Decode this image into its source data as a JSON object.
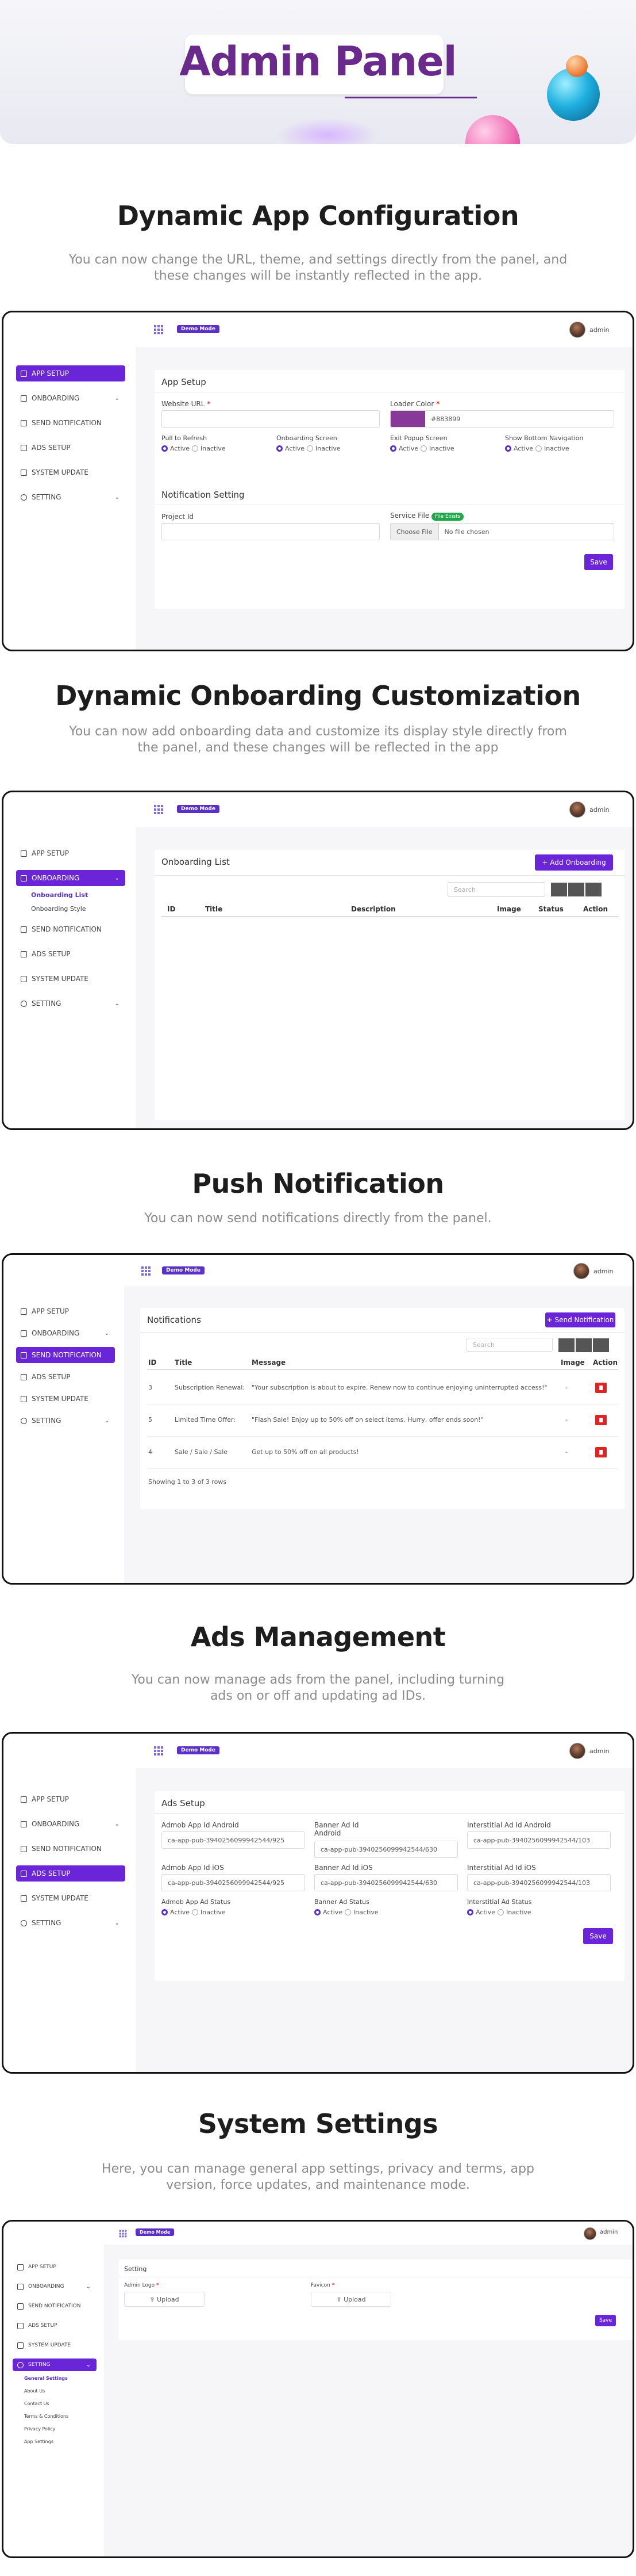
{
  "hero": {
    "title": "Admin Panel"
  },
  "sections": [
    {
      "title": "Dynamic App Configuration",
      "desc": "You can now change the URL, theme, and settings directly from the panel, and these changes will be instantly reflected in the app."
    },
    {
      "title": "Dynamic Onboarding Customization",
      "desc": "You can now add onboarding data and customize its display style directly from the panel, and these changes will be reflected in the app"
    },
    {
      "title": "Push Notification",
      "desc": "You can now send notifications directly from the panel."
    },
    {
      "title": "Ads Management",
      "desc": "You can now manage ads from the panel, including turning ads on or off and updating ad IDs."
    },
    {
      "title": "System Settings",
      "desc": "Here, you can manage general app settings, privacy and terms, app version, force updates, and maintenance mode."
    }
  ],
  "topbar": {
    "mode": "Demo Mode",
    "user": "admin"
  },
  "sidebar": {
    "items": [
      "APP SETUP",
      "ONBOARDING",
      "SEND NOTIFICATION",
      "ADS SETUP",
      "SYSTEM UPDATE",
      "SETTING"
    ],
    "onboarding_sub": [
      "Onboarding List",
      "Onboarding Style"
    ],
    "setting_sub": [
      "General Settings",
      "About Us",
      "Contact Us",
      "Terms & Conditions",
      "Privacy Policy",
      "App Settings"
    ]
  },
  "app_setup": {
    "title": "App Setup",
    "website_label": "Website URL",
    "loader_label": "Loader Color",
    "loader_value": "#883899",
    "loader_color": "#883899",
    "toggles": [
      "Pull to Refresh",
      "Onboarding Screen",
      "Exit Popup Screen",
      "Show Bottom Navigation"
    ],
    "active": "Active",
    "inactive": "Inactive",
    "notif_title": "Notification Setting",
    "project_label": "Project Id",
    "service_label": "Service File",
    "file_exists": "File Exists",
    "choose_file": "Choose File",
    "no_file": "No file chosen",
    "save": "Save"
  },
  "onboarding": {
    "title": "Onboarding List",
    "add": "+ Add Onboarding",
    "search": "Search",
    "columns": [
      "ID",
      "Title",
      "Description",
      "Image",
      "Status",
      "Action"
    ]
  },
  "notifications": {
    "title": "Notifications",
    "send": "+ Send Notification",
    "search": "Search",
    "columns": [
      "ID",
      "Title",
      "Message",
      "Image",
      "Action"
    ],
    "rows": [
      {
        "id": "3",
        "title": "Subscription Renewal:",
        "message": "\"Your subscription is about to expire. Renew now to continue enjoying uninterrupted access!\"",
        "image": "-"
      },
      {
        "id": "5",
        "title": "Limited Time Offer:",
        "message": "\"Flash Sale! Enjoy up to 50% off on select items. Hurry, offer ends soon!\"",
        "image": "-"
      },
      {
        "id": "4",
        "title": "Sale / Sale / Sale",
        "message": "Get up to 50% off on all products!",
        "image": "-"
      }
    ],
    "footer": "Showing 1 to 3 of 3 rows"
  },
  "ads": {
    "title": "Ads Setup",
    "fields": [
      {
        "label": "Admob App Id Android",
        "value": "ca-app-pub-3940256099942544/925"
      },
      {
        "label": "Banner Ad Id Android",
        "value": "ca-app-pub-3940256099942544/630"
      },
      {
        "label": "Interstitial Ad Id Android",
        "value": "ca-app-pub-3940256099942544/103"
      },
      {
        "label": "Admob App Id iOS",
        "value": "ca-app-pub-3940256099942544/925"
      },
      {
        "label": "Banner Ad Id iOS",
        "value": "ca-app-pub-3940256099942544/630"
      },
      {
        "label": "Interstitial Ad Id iOS",
        "value": "ca-app-pub-3940256099942544/103"
      }
    ],
    "status": [
      "Admob App Ad Status",
      "Banner Ad Status",
      "Interstitial Ad Status"
    ],
    "active": "Active",
    "inactive": "Inactive",
    "save": "Save"
  },
  "settings": {
    "title": "Setting",
    "logo_label": "Admin Logo",
    "favicon_label": "Favicon",
    "upload": "Upload",
    "save": "Save"
  }
}
